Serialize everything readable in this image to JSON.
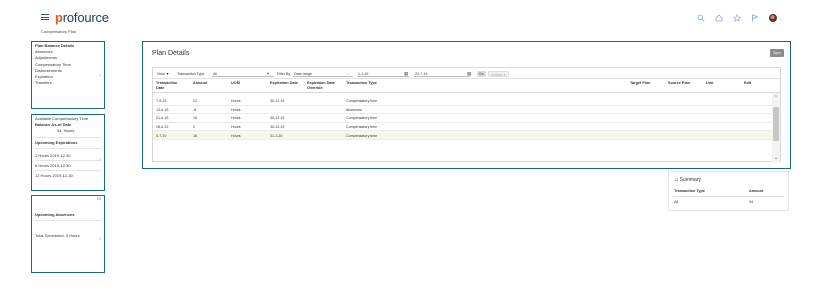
{
  "header": {
    "logo_prefix": "p",
    "logo_rest": "rofource",
    "subtitle": "Compensatory Plan",
    "icons": [
      "search-icon",
      "home-icon",
      "star-icon",
      "flag-icon",
      "avatar"
    ]
  },
  "plan_balance": {
    "items": [
      {
        "label": "Plan Balance Details",
        "bold": true
      },
      {
        "label": "Absences"
      },
      {
        "label": "Adjustments"
      },
      {
        "label": "Compensatory Time"
      },
      {
        "label": "Disbursements"
      },
      {
        "label": "Expiration"
      },
      {
        "label": "Transfers"
      }
    ]
  },
  "available_comp_time": {
    "title": "Available Compensatory Time",
    "balance_label": "Balance As-of Date",
    "balance_value": "34",
    "balance_unit": "Hours",
    "upcoming_title": "Upcoming Expirations",
    "expirations": [
      "2 Hours 2019-12-30",
      "6 Hours 2019-12-30",
      "12 Hours 2019-12-30"
    ]
  },
  "upcoming_absences": {
    "title": "Upcoming Absences",
    "total_label": "Total Scheduled: 0 Hours"
  },
  "plan_details": {
    "title": "Plan Details",
    "sync_label": "Sync",
    "toolbar": {
      "view_label": "View ▼",
      "transaction_type_label": "Transaction Type",
      "transaction_type_value": "All",
      "filter_by_label": "Filter By",
      "filter_by_value": "Date range",
      "date_from": "1-1-19",
      "date_to": "23-7-19",
      "go_label": "Go",
      "actions_label": "Actions"
    },
    "columns": [
      "Transaction Date",
      "Amount",
      "UOM",
      "Expiration Date",
      "Expiration Date Override",
      "Transaction Type",
      "Target Plan",
      "Source Plan",
      "Unit",
      "Edit"
    ],
    "rows": [
      {
        "date": "7-8-19",
        "amount": "12",
        "uom": "Hours",
        "exp": "30-12-19",
        "type": "Compensatory time",
        "selected": false
      },
      {
        "date": "13-6-19",
        "amount": "-8",
        "uom": "Hours",
        "exp": "",
        "type": "Absences",
        "selected": false
      },
      {
        "date": "21-6-19",
        "amount": "16",
        "uom": "Hours",
        "exp": "30-12-19",
        "type": "Compensatory time",
        "selected": false
      },
      {
        "date": "28-6-19",
        "amount": "2",
        "uom": "Hours",
        "exp": "30-12-19",
        "type": "Compensatory time",
        "selected": false
      },
      {
        "date": "5-7-19",
        "amount": "16",
        "uom": "Hours",
        "exp": "31-1-20",
        "type": "Compensatory time",
        "selected": true
      }
    ]
  },
  "summary": {
    "title": "Summary",
    "col_type": "Transaction Type",
    "col_amount": "Amount",
    "type_value": "All",
    "amount_value": "34"
  }
}
